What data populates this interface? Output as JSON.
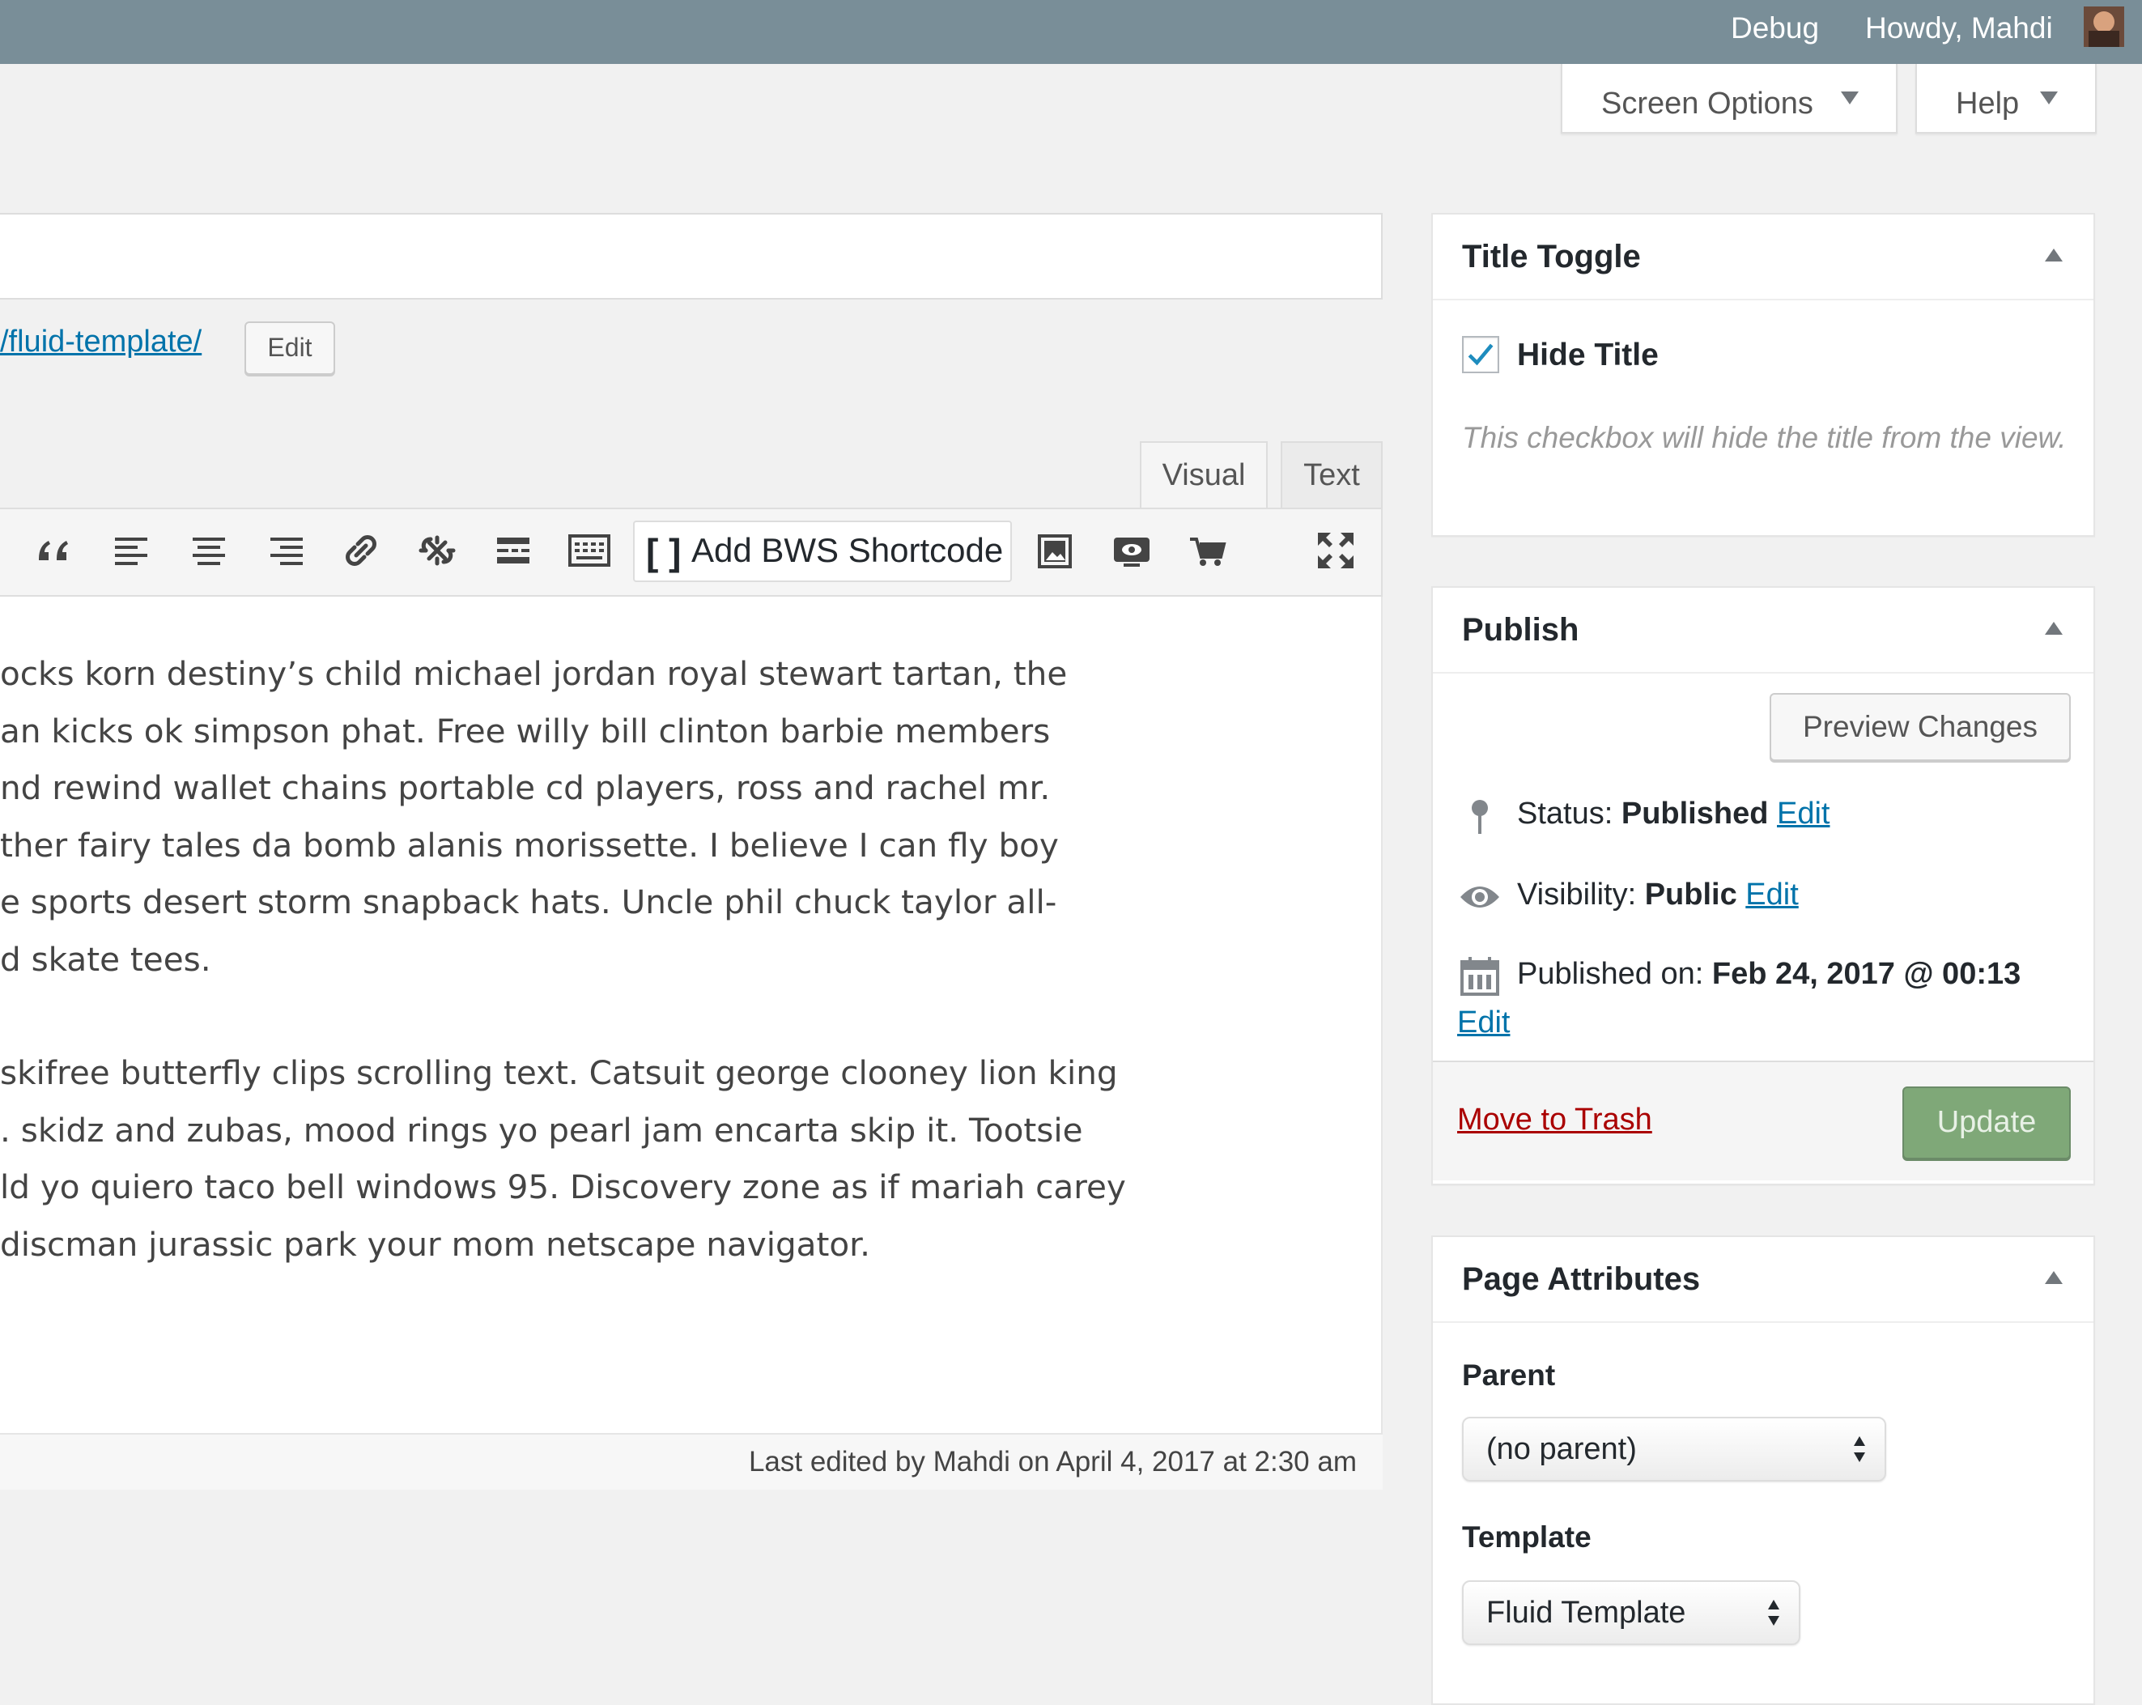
{
  "admin_bar": {
    "debug": "Debug",
    "howdy": "Howdy, Mahdi"
  },
  "screen_meta": {
    "screen_options": "Screen Options",
    "help": "Help"
  },
  "permalink": {
    "path": "/fluid-template/",
    "edit": "Edit"
  },
  "editor": {
    "tabs": [
      "Visual",
      "Text"
    ],
    "toolbar_icons": [
      "blockquote-icon",
      "align-left-icon",
      "align-center-icon",
      "align-right-icon",
      "insert-link-icon",
      "remove-link-icon",
      "read-more-icon",
      "toolbar-toggle-icon"
    ],
    "bws_shortcode": "Add BWS Shortcode",
    "extra_icons": [
      "gallery-icon",
      "preview-icon",
      "cart-icon",
      "fullscreen-icon"
    ],
    "paragraph1": [
      "ocks korn destiny’s child michael jordan royal stewart tartan, the",
      "an kicks ok simpson phat. Free willy bill clinton barbie members",
      "nd rewind wallet chains portable cd players, ross and rachel mr.",
      "ther fairy tales da bomb alanis morissette. I believe I can fly boy",
      "e sports desert storm snapback hats. Uncle phil chuck taylor all-",
      "d skate tees."
    ],
    "paragraph2": [
      " skifree butterfly clips scrolling text. Catsuit george clooney lion king",
      ". skidz and zubas, mood rings yo pearl jam encarta skip it. Tootsie",
      "ld yo quiero taco bell windows 95. Discovery zone as if mariah carey",
      "discman jurassic park your mom netscape navigator."
    ],
    "last_edited": "Last edited by Mahdi on April 4, 2017 at 2:30 am"
  },
  "title_toggle": {
    "heading": "Title Toggle",
    "checkbox_label": "Hide Title",
    "checked": true,
    "description": "This checkbox will hide the title from the view."
  },
  "publish": {
    "heading": "Publish",
    "preview": "Preview Changes",
    "status_label": "Status:",
    "status_value": "Published",
    "visibility_label": "Visibility:",
    "visibility_value": "Public",
    "published_label": "Published on:",
    "published_value": "Feb 24, 2017 @ 00:13",
    "edit": "Edit",
    "trash": "Move to Trash",
    "update": "Update"
  },
  "page_attributes": {
    "heading": "Page Attributes",
    "parent_label": "Parent",
    "parent_value": "(no parent)",
    "template_label": "Template",
    "template_value": "Fluid Template"
  },
  "colors": {
    "admin_bar": "#798e98",
    "link": "#0073aa",
    "trash": "#aa0000",
    "update_button": "#7fa878"
  }
}
